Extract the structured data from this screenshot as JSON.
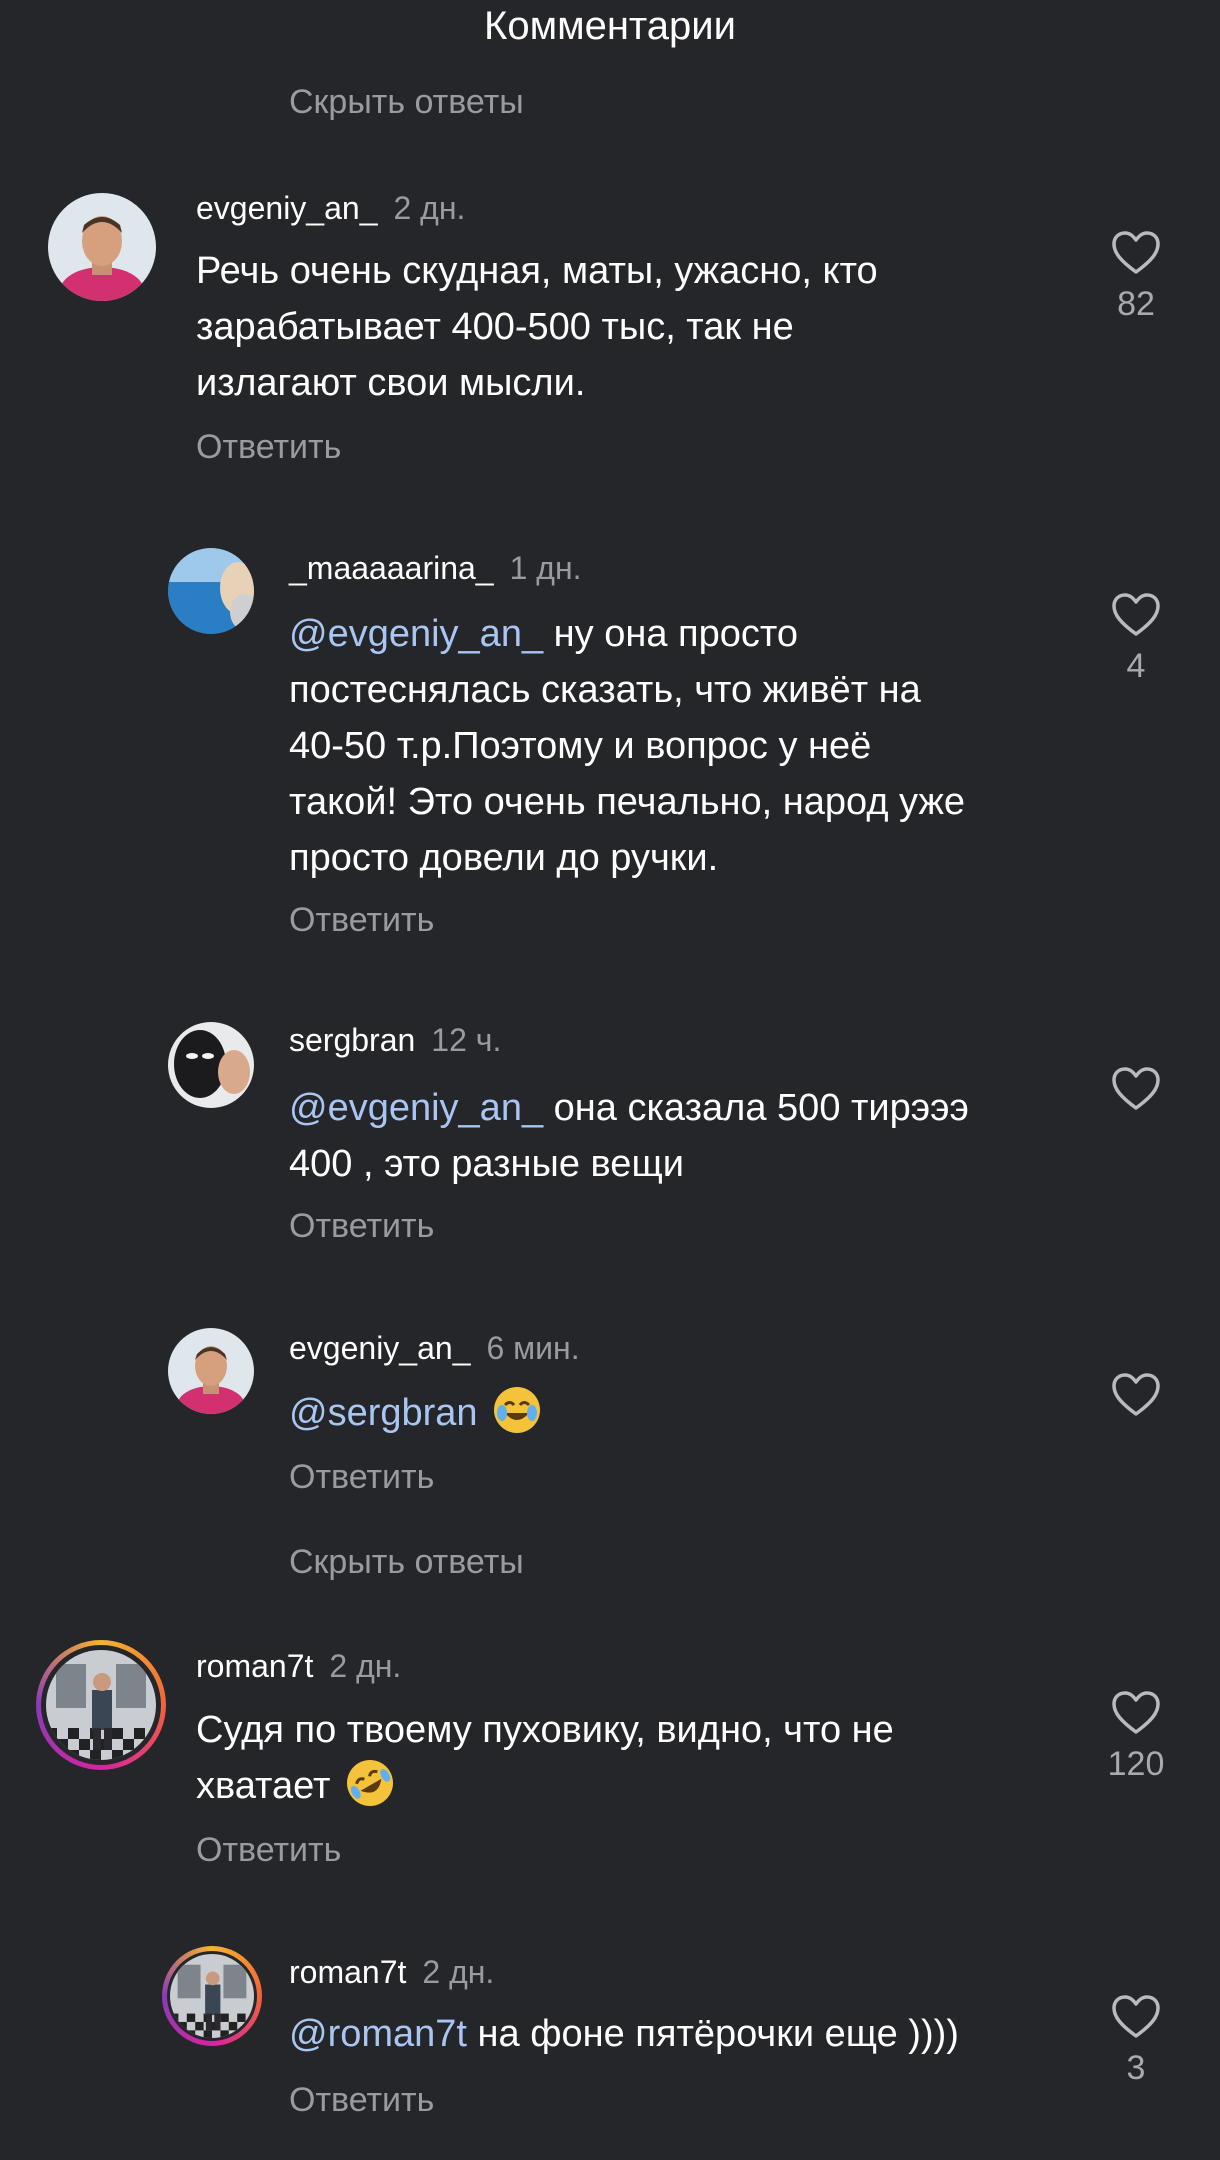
{
  "header": {
    "title": "Комментарии"
  },
  "hide_replies_label": "Скрыть ответы",
  "reply_label": "Ответить",
  "colors": {
    "background": "#25262a",
    "mention": "#a9c6f2",
    "secondary_text": "#9a9ba0"
  },
  "comments": [
    {
      "user": "evgeniy_an_",
      "time": "2 дн.",
      "text_lines": [
        "Речь очень скудная, маты, ужасно, кто",
        "зарабатывает 400-500 тыс, так не",
        "излагают свои мысли."
      ],
      "likes": "82"
    },
    {
      "user": "_maaaaarina_",
      "time": "1 дн.",
      "mention": "@evgeniy_an_",
      "text_first_line": " ну она просто",
      "text_lines": [
        "постеснялась сказать, что живёт на",
        "40-50 т.р.Поэтому и вопрос у неё",
        "такой! Это очень печально, народ уже",
        "просто довели до ручки."
      ],
      "likes": "4"
    },
    {
      "user": "sergbran",
      "time": "12 ч.",
      "mention": "@evgeniy_an_",
      "text_first_line": " она сказала 500 тирэээ",
      "text_lines": [
        "400 , это разные вещи"
      ],
      "likes": ""
    },
    {
      "user": "evgeniy_an_",
      "time": "6 мин.",
      "mention": "@sergbran",
      "text_first_line": " ",
      "emoji": "face-with-tears-of-joy",
      "likes": ""
    },
    {
      "user": "roman7t",
      "time": "2 дн.",
      "text_lines": [
        "Судя по твоему пуховику, видно, что не",
        "хватает "
      ],
      "emoji": "rolling-on-floor-laughing",
      "likes": "120"
    },
    {
      "user": "roman7t",
      "time": "2 дн.",
      "mention": "@roman7t",
      "text_first_line": " на фоне пятёрочки еще ))))",
      "likes": "3"
    }
  ]
}
